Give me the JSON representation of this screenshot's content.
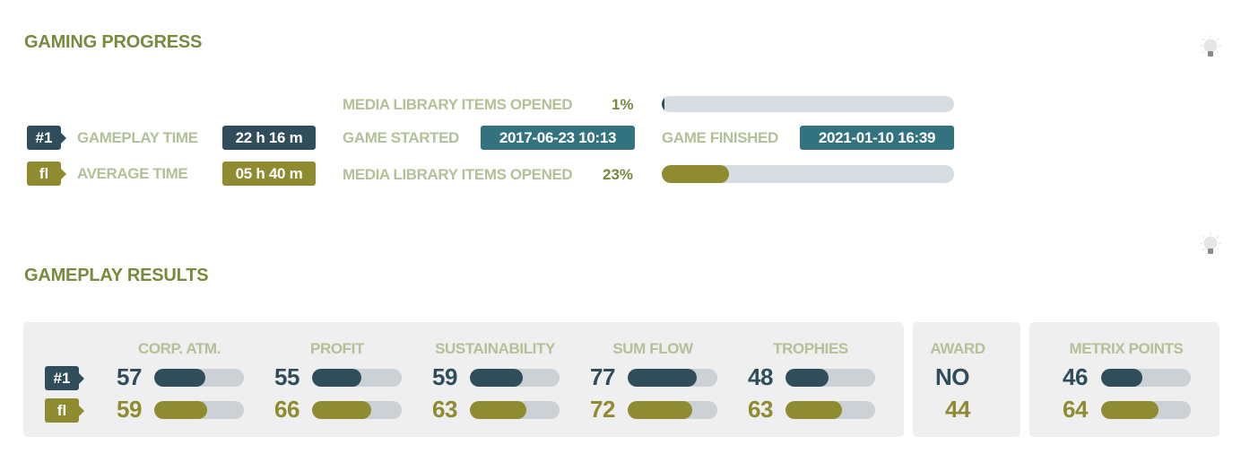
{
  "progress": {
    "title": "GAMING PROGRESS",
    "hint_icon": "lightbulb-icon",
    "player_tag": "#1",
    "average_tag": "fl",
    "gameplay_time_label": "GAMEPLAY TIME",
    "gameplay_time_value": "22 h 16 m",
    "average_time_label": "AVERAGE TIME",
    "average_time_value": "05 h 40 m",
    "media_top": {
      "label": "MEDIA LIBRARY ITEMS OPENED",
      "percent_text": "1%",
      "percent": 1
    },
    "game_started_label": "GAME STARTED",
    "game_started_value": "2017-06-23 10:13",
    "game_finished_label": "GAME FINISHED",
    "game_finished_value": "2021-01-10 16:39",
    "media_bottom": {
      "label": "MEDIA LIBRARY ITEMS OPENED",
      "percent_text": "23%",
      "percent": 23
    }
  },
  "results": {
    "title": "GAMEPLAY RESULTS",
    "hint_icon": "lightbulb-icon",
    "player_tag": "#1",
    "average_tag": "fl",
    "metrics": [
      {
        "name": "CORP. ATM.",
        "player": 57,
        "average": 59
      },
      {
        "name": "PROFIT",
        "player": 55,
        "average": 66
      },
      {
        "name": "SUSTAINABILITY",
        "player": 59,
        "average": 63
      },
      {
        "name": "SUM FLOW",
        "player": 77,
        "average": 72
      },
      {
        "name": "TROPHIES",
        "player": 48,
        "average": 63
      }
    ],
    "award": {
      "label": "AWARD",
      "player": "NO",
      "average": "44"
    },
    "metrix": {
      "label": "METRIX POINTS",
      "player": 46,
      "average": 64
    }
  },
  "colors": {
    "title_green": "#778a3e",
    "label_green": "#b3c198",
    "player_dark": "#2f4d5b",
    "average_olive": "#8f8b31",
    "date_teal": "#33737f",
    "track_gray": "#d6dde0",
    "panel_gray": "#efefef"
  }
}
